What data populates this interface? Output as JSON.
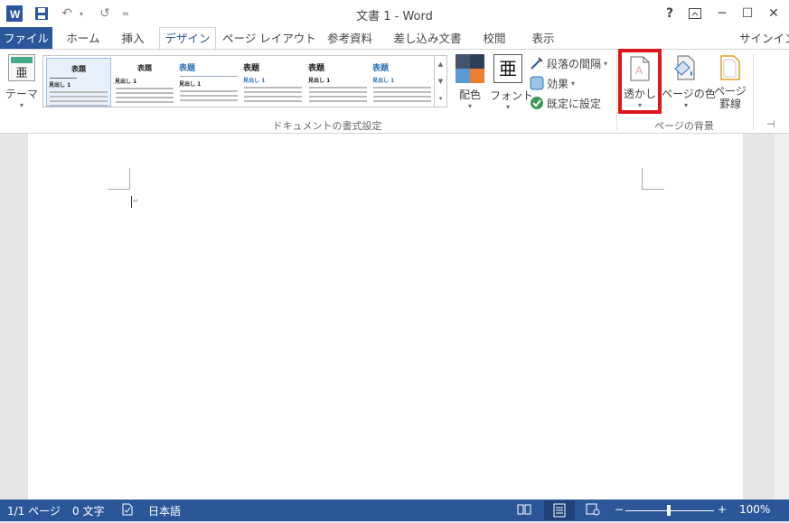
{
  "window": {
    "title": "文書 1 - Word",
    "help": "?",
    "restore_ribbon_icon": "ribbon-display-icon",
    "minimize": "─",
    "maximize": "☐",
    "close": "✕"
  },
  "quick_access": {
    "app_icon": "W",
    "save_icon": "save-icon",
    "undo": "↶",
    "redo": "↺",
    "customize": "="
  },
  "tabs": [
    "ファイル",
    "ホーム",
    "挿入",
    "デザイン",
    "ページ レイアウト",
    "参考資料",
    "差し込み文書",
    "校閲",
    "表示"
  ],
  "active_tab": "デザイン",
  "signin": "サインイン",
  "ribbon": {
    "theme_label": "テーマ",
    "theme_icon_glyph": "亜",
    "gallery": [
      {
        "title": "表題",
        "heading": "見出し 1"
      },
      {
        "title": "表題",
        "heading": "見出し 1"
      },
      {
        "title": "表題",
        "heading": "見出し 1"
      },
      {
        "title": "表題",
        "heading": "見出し 1"
      },
      {
        "title": "表題",
        "heading": "見出し 1"
      },
      {
        "title": "表題",
        "heading": "見出し 1"
      }
    ],
    "colors_label": "配色",
    "fonts_label": "フォント",
    "fonts_glyph": "亜",
    "paragraph_spacing": "段落の間隔",
    "effects": "効果",
    "set_default": "既定に設定",
    "doc_format_group": "ドキュメントの書式設定",
    "watermark_label": "透かし",
    "page_color_label": "ページの色",
    "page_borders_line1": "ページ",
    "page_borders_line2": "罫線",
    "page_bg_group": "ページの背景",
    "highlight_color": "#e0161c",
    "accent": "#2b579a"
  },
  "status": {
    "page": "1/1 ページ",
    "words": "0 文字",
    "language": "日本語",
    "zoom": "100%",
    "zoom_minus": "−",
    "zoom_plus": "+"
  }
}
